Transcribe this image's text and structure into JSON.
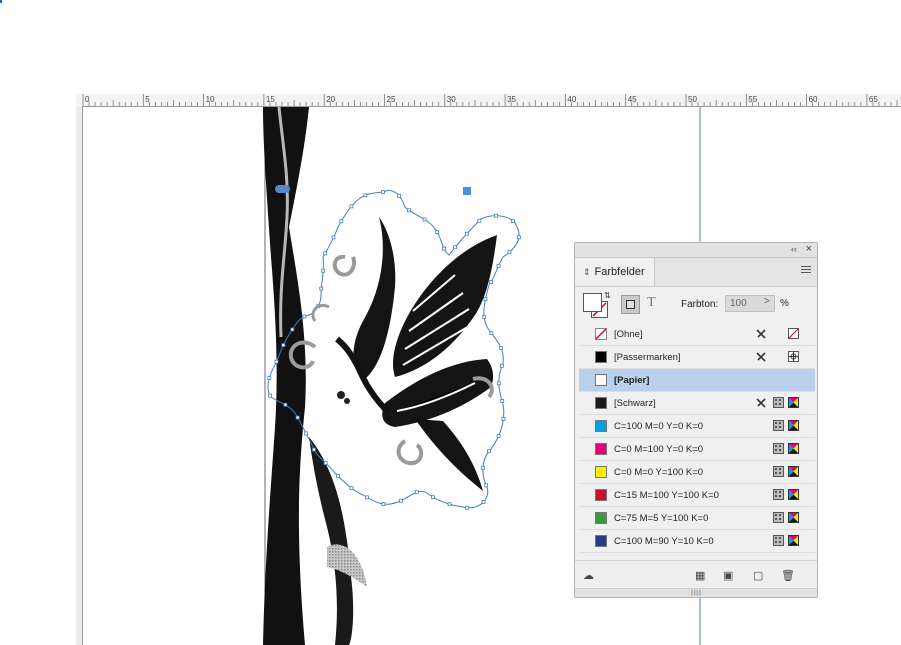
{
  "ruler": {
    "labels": [
      "0",
      "5",
      "10",
      "15",
      "20",
      "25",
      "30",
      "35",
      "40",
      "45",
      "50",
      "55",
      "60",
      "65"
    ]
  },
  "panel": {
    "title": "Farbfelder",
    "tint_label": "Farbton:",
    "tint_value": "100",
    "tint_arrow": ">",
    "tint_unit": "%",
    "format_text_glyph": "T",
    "collapse_glyph": "‹‹",
    "close_glyph": "×",
    "swatches": [
      {
        "name": "[Ohne]",
        "color": "none",
        "nonedit": true,
        "mode1": "none-icon",
        "mode2": ""
      },
      {
        "name": "[Passermarken]",
        "color": "#000000",
        "nonedit": true,
        "mode1": "registration-icon",
        "mode2": ""
      },
      {
        "name": "[Papier]",
        "color": "#ffffff",
        "nonedit": false,
        "mode1": "",
        "mode2": "",
        "selected": true
      },
      {
        "name": "[Schwarz]",
        "color": "#1a1a1a",
        "nonedit": true,
        "mode1": "process-icon",
        "mode2": "cmyk-icon"
      },
      {
        "name": "C=100 M=0 Y=0 K=0",
        "color": "#00a0e3",
        "nonedit": false,
        "mode1": "process-icon",
        "mode2": "cmyk-icon"
      },
      {
        "name": "C=0 M=100 Y=0 K=0",
        "color": "#e6007e",
        "nonedit": false,
        "mode1": "process-icon",
        "mode2": "cmyk-icon"
      },
      {
        "name": "C=0 M=0 Y=100 K=0",
        "color": "#ffed00",
        "nonedit": false,
        "mode1": "process-icon",
        "mode2": "cmyk-icon"
      },
      {
        "name": "C=15 M=100 Y=100 K=0",
        "color": "#c8102e",
        "nonedit": false,
        "mode1": "process-icon",
        "mode2": "cmyk-icon"
      },
      {
        "name": "C=75 M=5 Y=100 K=0",
        "color": "#3a9a3a",
        "nonedit": false,
        "mode1": "process-icon",
        "mode2": "cmyk-icon"
      },
      {
        "name": "C=100 M=90 Y=10 K=0",
        "color": "#2b3a8c",
        "nonedit": false,
        "mode1": "process-icon",
        "mode2": "cmyk-icon"
      }
    ],
    "bottom_icons": [
      "cc-libraries-icon",
      "swatch-views-icon",
      "new-folder-icon",
      "new-swatch-icon",
      "trash-icon"
    ]
  },
  "colors": {
    "guide": "#5a7fa8",
    "selection_row": "#b9d1ec",
    "path_outline": "#3f7fbf",
    "selection_handle": "#4a90e2"
  }
}
